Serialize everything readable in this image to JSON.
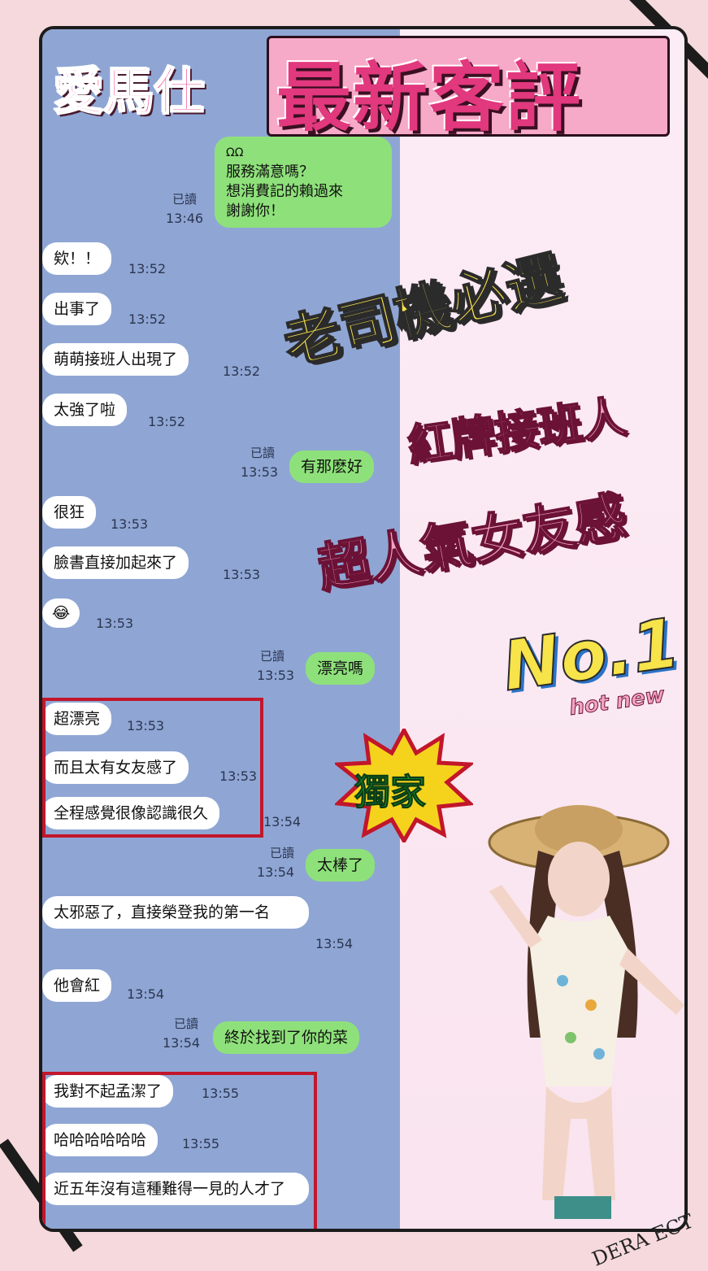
{
  "title": {
    "brand": "愛馬仕",
    "main": "最新客評"
  },
  "chat": {
    "first_message": {
      "sender_tag": "ΩΩ",
      "lines": [
        "服務滿意嗎？",
        "想消費記的賴過來",
        "謝謝你！"
      ],
      "read": "已讀",
      "time": "13:46"
    },
    "messages": [
      {
        "text": "欸！！",
        "time": "13:52"
      },
      {
        "text": "出事了",
        "time": "13:52"
      },
      {
        "text": "萌萌接班人出現了",
        "time": "13:52"
      },
      {
        "text": "太強了啦",
        "time": "13:52"
      },
      {
        "text": "有那麽好",
        "time": "13:53",
        "read": "已讀"
      },
      {
        "text": "很狂",
        "time": "13:53"
      },
      {
        "text": "臉書直接加起來了",
        "time": "13:53"
      },
      {
        "text": "😂",
        "time": "13:53"
      },
      {
        "text": "漂亮嗎",
        "time": "13:53",
        "read": "已讀"
      },
      {
        "text": "超漂亮",
        "time": "13:53"
      },
      {
        "text": "而且太有女友感了",
        "time": "13:53"
      },
      {
        "text": "全程感覺很像認識很久",
        "time": "13:54"
      },
      {
        "text": "太棒了",
        "time": "13:54",
        "read": "已讀"
      },
      {
        "text": "太邪惡了，直接榮登我的第一名",
        "time": "13:54"
      },
      {
        "text": "他會紅",
        "time": "13:54"
      },
      {
        "text": "終於找到了你的菜",
        "time": "13:54",
        "read": "已讀"
      },
      {
        "text": "我對不起孟潔了",
        "time": "13:55"
      },
      {
        "text": "哈哈哈哈哈哈",
        "time": "13:55"
      },
      {
        "text": "近五年沒有這種難得一見的人才了",
        "time": ""
      }
    ]
  },
  "promo": {
    "line1": "老司機必選",
    "line2": "紅牌接班人",
    "line3": "超人氣女友感",
    "no1": "No.1",
    "no1_sub": "hot new",
    "burst": "獨家"
  },
  "watermark": "DERA ECT",
  "colors": {
    "background": "#f6d9dc",
    "chat_bg": "#8fa6d4",
    "my_bubble": "#8ee17a",
    "highlight": "#c2162b",
    "title_pink": "#e2387d"
  }
}
